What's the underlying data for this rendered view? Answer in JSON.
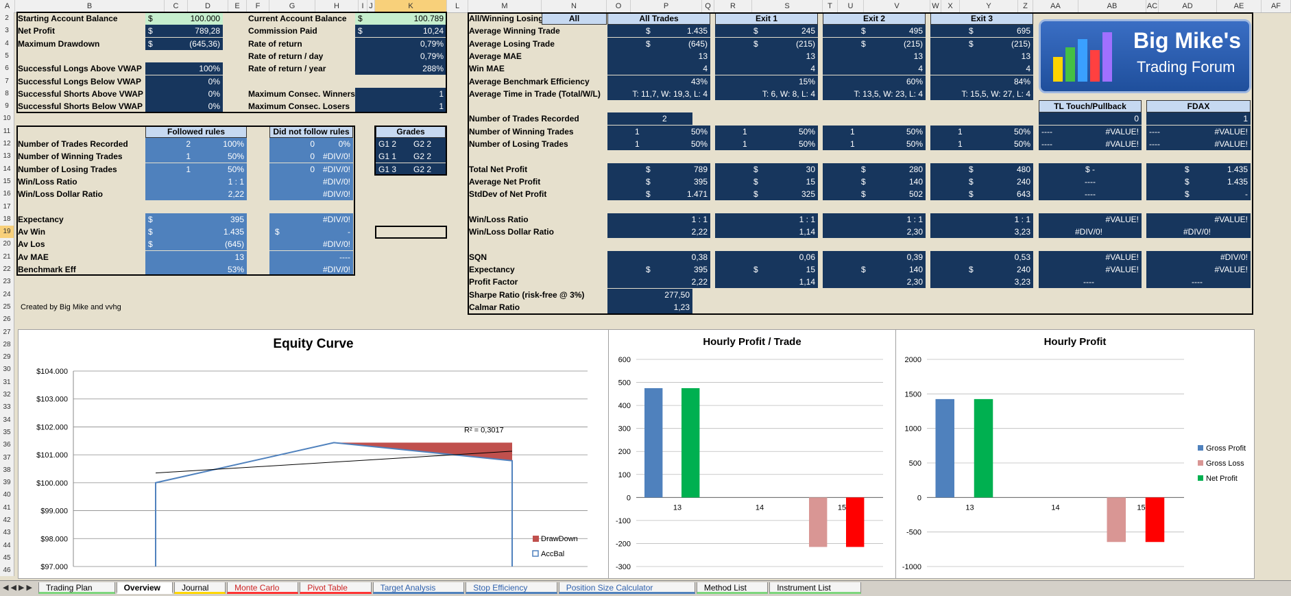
{
  "column_headers": [
    "A",
    "B",
    "C",
    "D",
    "E",
    "F",
    "G",
    "H",
    "I",
    "J",
    "K",
    "L",
    "M",
    "N",
    "O",
    "P",
    "Q",
    "R",
    "S",
    "T",
    "U",
    "V",
    "W",
    "X",
    "Y",
    "Z",
    "AA",
    "AB",
    "AC",
    "AD",
    "AE",
    "AF"
  ],
  "row_numbers": [
    "2",
    "3",
    "4",
    "5",
    "6",
    "7",
    "8",
    "9",
    "10",
    "11",
    "12",
    "13",
    "14",
    "15",
    "16",
    "17",
    "18",
    "19",
    "20",
    "21",
    "22",
    "23",
    "24",
    "25",
    "26",
    "27",
    "28",
    "29",
    "30",
    "31",
    "32",
    "33",
    "34",
    "35",
    "36",
    "37",
    "38",
    "39",
    "40",
    "41",
    "42",
    "43",
    "44",
    "45",
    "46"
  ],
  "summary": {
    "starting_balance_label": "Starting Account Balance",
    "starting_balance_cur": "$",
    "starting_balance": "100.000",
    "net_profit_label": "Net Profit",
    "net_profit_cur": "$",
    "net_profit": "789,28",
    "max_dd_label": "Maximum Drawdown",
    "max_dd_cur": "$",
    "max_dd": "(645,36)",
    "current_balance_label": "Current Account Balance",
    "current_balance_cur": "$",
    "current_balance": "100.789",
    "commission_label": "Commission Paid",
    "commission_cur": "$",
    "commission": "10,24",
    "ror_label": "Rate of return",
    "ror": "0,79%",
    "ror_day_label": "Rate of return / day",
    "ror_day": "0,79%",
    "ror_year_label": "Rate of return / year",
    "ror_year": "288%",
    "sla_label": "Successful Longs Above VWAP",
    "sla": "100%",
    "slb_label": "Successful Longs Below VWAP",
    "slb": "0%",
    "ssa_label": "Successful Shorts Above VWAP",
    "ssa": "0%",
    "ssb_label": "Successful Shorts Below VWAP",
    "ssb": "0%",
    "mcw_label": "Maximum Consec. Winners",
    "mcw": "1",
    "mcl_label": "Maximum Consec. Losers",
    "mcl": "1"
  },
  "rules": {
    "followed": "Followed rules",
    "not_followed": "Did not follow rules",
    "rows": [
      {
        "label": "Number of Trades Recorded",
        "f1": "2",
        "f2": "100%",
        "n1": "0",
        "n2": "0%"
      },
      {
        "label": "Number of Winning Trades",
        "f1": "1",
        "f2": "50%",
        "n1": "0",
        "n2": "#DIV/0!"
      },
      {
        "label": "Number of Losing Trades",
        "f1": "1",
        "f2": "50%",
        "n1": "0",
        "n2": "#DIV/0!"
      },
      {
        "label": "Win/Loss Ratio",
        "f1": "",
        "f2": "1 : 1",
        "n1": "",
        "n2": "#DIV/0!"
      },
      {
        "label": "Win/Loss Dollar Ratio",
        "f1": "",
        "f2": "2,22",
        "n1": "",
        "n2": "#DIV/0!"
      }
    ],
    "rows2": [
      {
        "label": "Expectancy",
        "fc": "$",
        "fv": "395",
        "nc": "",
        "nv": "#DIV/0!"
      },
      {
        "label": "Av Win",
        "fc": "$",
        "fv": "1.435",
        "nc": "$",
        "nv": "-"
      },
      {
        "label": "Av Los",
        "fc": "$",
        "fv": "(645)",
        "nc": "",
        "nv": "#DIV/0!"
      },
      {
        "label": "Av MAE",
        "fc": "",
        "fv": "13",
        "nc": "",
        "nv": "----"
      },
      {
        "label": "Benchmark Eff",
        "fc": "",
        "fv": "53%",
        "nc": "",
        "nv": "#DIV/0!"
      }
    ],
    "created": "Created by Big Mike and vvhg"
  },
  "grades": {
    "title": "Grades",
    "rows": [
      [
        "G1 2",
        "G2 2"
      ],
      [
        "G1 1",
        "G2 2"
      ],
      [
        "G1 3",
        "G2 2"
      ]
    ]
  },
  "stats": {
    "corner": "All/Winning Losing",
    "all": "All",
    "groups": [
      "All Trades",
      "Exit 1",
      "Exit 2",
      "Exit 3"
    ],
    "rows": [
      {
        "label": "Average Winning Trade",
        "v": [
          [
            "$",
            "1.435"
          ],
          [
            "$",
            "245"
          ],
          [
            "$",
            "495"
          ],
          [
            "$",
            "695"
          ]
        ]
      },
      {
        "label": "Average Losing Trade",
        "v": [
          [
            "$",
            "(645)"
          ],
          [
            "$",
            "(215)"
          ],
          [
            "$",
            "(215)"
          ],
          [
            "$",
            "(215)"
          ]
        ]
      },
      {
        "label": "Average MAE",
        "v": [
          [
            "",
            "13"
          ],
          [
            "",
            "13"
          ],
          [
            "",
            "13"
          ],
          [
            "",
            "13"
          ]
        ]
      },
      {
        "label": "Win MAE",
        "v": [
          [
            "",
            "4"
          ],
          [
            "",
            "4"
          ],
          [
            "",
            "4"
          ],
          [
            "",
            "4"
          ]
        ]
      },
      {
        "label": "Average Benchmark Efficiency",
        "v": [
          [
            "",
            "43%"
          ],
          [
            "",
            "15%"
          ],
          [
            "",
            "60%"
          ],
          [
            "",
            "84%"
          ]
        ]
      },
      {
        "label": "Average Time in Trade (Total/W/L)",
        "v": [
          [
            "",
            "T: 11,7, W: 19,3, L: 4"
          ],
          [
            "",
            "T: 6, W: 8, L: 4"
          ],
          [
            "",
            "T: 13,5, W: 23, L: 4"
          ],
          [
            "",
            "T: 15,5, W: 27, L: 4"
          ]
        ]
      }
    ],
    "trades_label": "Number of Trades Recorded",
    "trades": "2",
    "wl_rows": [
      {
        "label": "Number of Winning Trades",
        "v": [
          [
            "1",
            "50%"
          ],
          [
            "1",
            "50%"
          ],
          [
            "1",
            "50%"
          ],
          [
            "1",
            "50%"
          ]
        ]
      },
      {
        "label": "Number of Losing Trades",
        "v": [
          [
            "1",
            "50%"
          ],
          [
            "1",
            "50%"
          ],
          [
            "1",
            "50%"
          ],
          [
            "1",
            "50%"
          ]
        ]
      }
    ],
    "np_rows": [
      {
        "label": "Total Net Profit",
        "v": [
          [
            "$",
            "789"
          ],
          [
            "$",
            "30"
          ],
          [
            "$",
            "280"
          ],
          [
            "$",
            "480"
          ]
        ]
      },
      {
        "label": "Average Net Profit",
        "v": [
          [
            "$",
            "395"
          ],
          [
            "$",
            "15"
          ],
          [
            "$",
            "140"
          ],
          [
            "$",
            "240"
          ]
        ]
      },
      {
        "label": "StdDev of Net Profit",
        "v": [
          [
            "$",
            "1.471"
          ],
          [
            "$",
            "325"
          ],
          [
            "$",
            "502"
          ],
          [
            "$",
            "643"
          ]
        ]
      }
    ],
    "ratio_rows": [
      {
        "label": "Win/Loss Ratio",
        "v": [
          "1 : 1",
          "1 : 1",
          "1 : 1",
          "1 : 1"
        ]
      },
      {
        "label": "Win/Loss Dollar Ratio",
        "v": [
          "2,22",
          "1,14",
          "2,30",
          "3,23"
        ]
      }
    ],
    "sqn_rows": [
      {
        "label": "SQN",
        "v": [
          [
            "",
            "0,38"
          ],
          [
            "",
            "0,06"
          ],
          [
            "",
            "0,39"
          ],
          [
            "",
            "0,53"
          ]
        ]
      },
      {
        "label": "Expectancy",
        "v": [
          [
            "$",
            "395"
          ],
          [
            "$",
            "15"
          ],
          [
            "$",
            "140"
          ],
          [
            "$",
            "240"
          ]
        ]
      },
      {
        "label": "Profit Factor",
        "v": [
          [
            "",
            "2,22"
          ],
          [
            "",
            "1,14"
          ],
          [
            "",
            "2,30"
          ],
          [
            "",
            "3,23"
          ]
        ]
      }
    ],
    "sharpe_label": "Sharpe Ratio (risk-free @ 3%)",
    "sharpe": "277,50",
    "calmar_label": "Calmar Ratio",
    "calmar": "1,23"
  },
  "extra": {
    "tl": "TL Touch/Pullback",
    "fdax": "FDAX",
    "top_tl": "0",
    "top_fdax": "1",
    "rows": [
      {
        "tl": [
          "----",
          "#VALUE!"
        ],
        "fd": [
          "----",
          "#VALUE!"
        ]
      },
      {
        "tl": [
          "----",
          "#VALUE!"
        ],
        "fd": [
          "----",
          "#VALUE!"
        ]
      }
    ],
    "np": [
      {
        "tl": "$          -",
        "fd": [
          "$",
          "1.435"
        ]
      },
      {
        "tl": "----",
        "fd": [
          "$",
          "1.435"
        ]
      },
      {
        "tl": "----",
        "fd": [
          "$",
          "-"
        ]
      }
    ],
    "ratio": [
      {
        "tl": "#VALUE!",
        "fd": "#VALUE!"
      },
      {
        "tl": "#DIV/0!",
        "fd": "#DIV/0!"
      }
    ],
    "sqn": [
      {
        "tl": "#VALUE!",
        "fd": "#DIV/0!"
      },
      {
        "tl": "#VALUE!",
        "fd": "#VALUE!"
      },
      {
        "tl": "----",
        "fd": "----"
      }
    ]
  },
  "logo": {
    "line1": "Big Mike's",
    "line2": "Trading Forum"
  },
  "chart_data": [
    {
      "type": "line",
      "title": "Equity Curve",
      "x": [
        1,
        2,
        3,
        4
      ],
      "series": [
        {
          "name": "AccBal",
          "values": [
            97000,
            100000,
            101435,
            100789
          ]
        },
        {
          "name": "DrawDown",
          "values": [
            0,
            0,
            645,
            645
          ]
        }
      ],
      "trendline": {
        "r2_label": "R² = 0,3017"
      },
      "ylim": [
        97000,
        104000
      ],
      "yticks": [
        "$97.000",
        "$98.000",
        "$99.000",
        "$100.000",
        "$101.000",
        "$102.000",
        "$103.000",
        "$104.000"
      ],
      "legend": "right"
    },
    {
      "type": "bar",
      "title": "Hourly Profit / Trade",
      "categories": [
        "13",
        "14",
        "15"
      ],
      "series": [
        {
          "name": "Gross Profit",
          "values": [
            475,
            0,
            0
          ]
        },
        {
          "name": "Gross Loss",
          "values": [
            0,
            0,
            -215
          ]
        },
        {
          "name": "Net Profit",
          "values": [
            475,
            0,
            -215
          ]
        }
      ],
      "ylim": [
        -300,
        600
      ],
      "yticks": [
        "-300",
        "-200",
        "-100",
        "0",
        "100",
        "200",
        "300",
        "400",
        "500",
        "600"
      ]
    },
    {
      "type": "bar",
      "title": "Hourly Profit",
      "categories": [
        "13",
        "14",
        "15"
      ],
      "series": [
        {
          "name": "Gross Profit",
          "values": [
            1425,
            0,
            0
          ]
        },
        {
          "name": "Gross Loss",
          "values": [
            0,
            0,
            -645
          ]
        },
        {
          "name": "Net Profit",
          "values": [
            1425,
            0,
            -645
          ]
        }
      ],
      "ylim": [
        -1000,
        2000
      ],
      "yticks": [
        "-1000",
        "-500",
        "0",
        "500",
        "1000",
        "1500",
        "2000"
      ],
      "legend": "right"
    }
  ],
  "tabs": [
    {
      "label": "Trading Plan",
      "color": "#7cd67c"
    },
    {
      "label": "Overview",
      "color": "#ffffff"
    },
    {
      "label": "Journal",
      "color": "#ffd700"
    },
    {
      "label": "Monte Carlo",
      "color": "#ff3333"
    },
    {
      "label": "Pivot Table",
      "color": "#ff3333"
    },
    {
      "label": "Target Analysis",
      "color": "#4f81bd"
    },
    {
      "label": "Stop Efficiency",
      "color": "#4f81bd"
    },
    {
      "label": "Position Size Calculator",
      "color": "#4f81bd"
    },
    {
      "label": "Method List",
      "color": "#7cd67c"
    },
    {
      "label": "Instrument List",
      "color": "#7cd67c"
    }
  ]
}
